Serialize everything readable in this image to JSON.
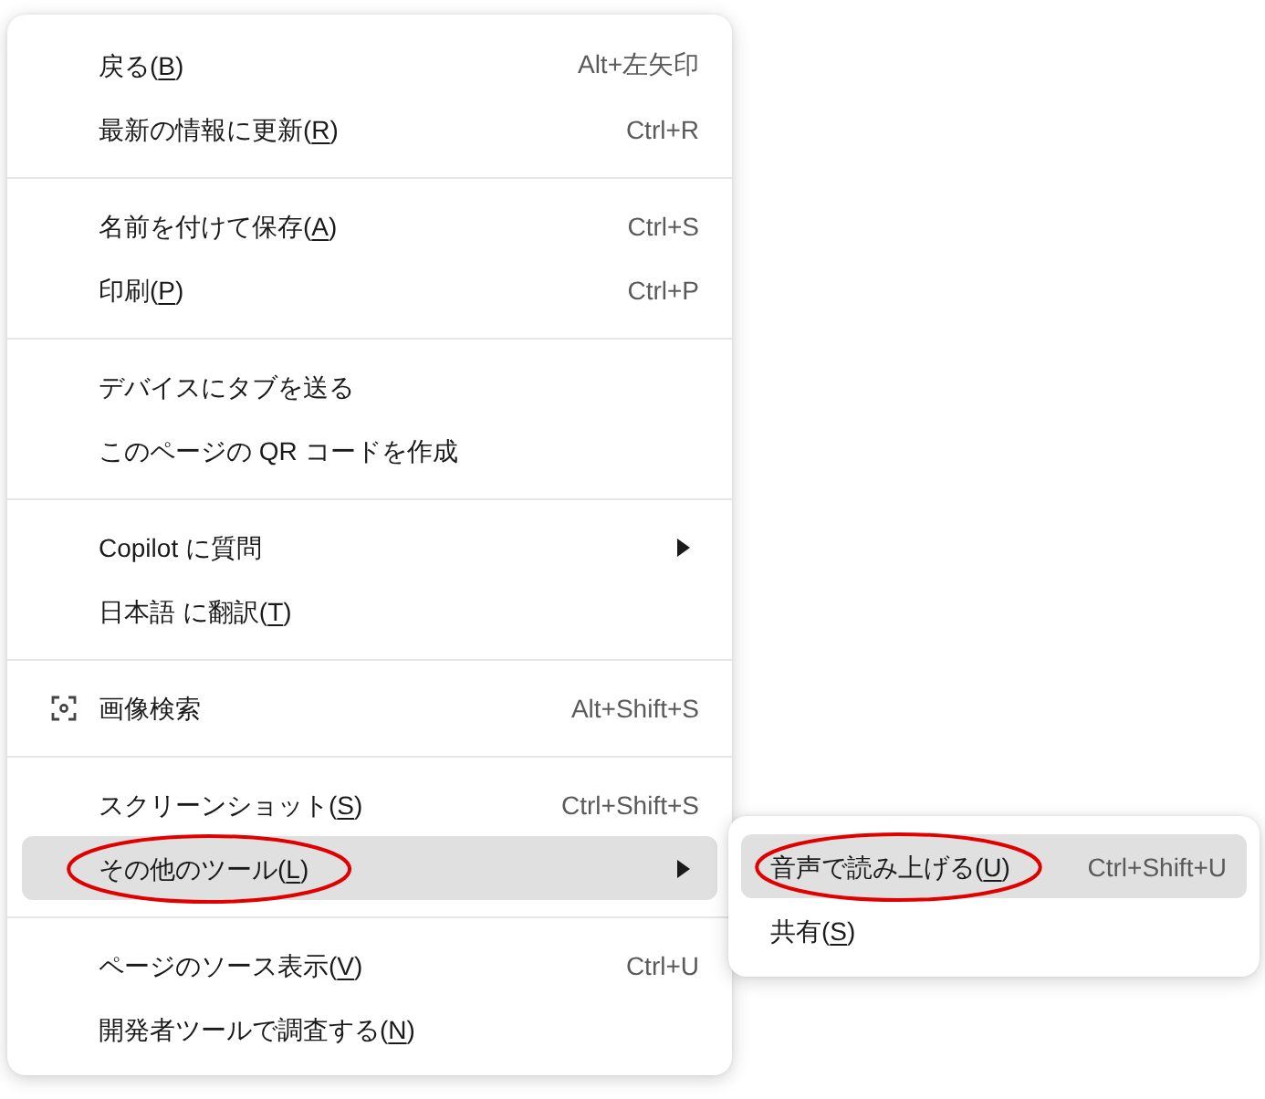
{
  "context_menu": {
    "sections": [
      {
        "items": [
          {
            "label": "戻る(",
            "access_key": "B",
            "label_end": ")",
            "shortcut": "Alt+左矢印",
            "has_icon": false,
            "has_submenu": false,
            "selected": false,
            "circled": false
          },
          {
            "label": "最新の情報に更新(",
            "access_key": "R",
            "label_end": ")",
            "shortcut": "Ctrl+R",
            "has_icon": false,
            "has_submenu": false,
            "selected": false,
            "circled": false
          }
        ]
      },
      {
        "items": [
          {
            "label": "名前を付けて保存(",
            "access_key": "A",
            "label_end": ")",
            "shortcut": "Ctrl+S",
            "has_icon": false,
            "has_submenu": false,
            "selected": false,
            "circled": false
          },
          {
            "label": "印刷(",
            "access_key": "P",
            "label_end": ")",
            "shortcut": "Ctrl+P",
            "has_icon": false,
            "has_submenu": false,
            "selected": false,
            "circled": false
          }
        ]
      },
      {
        "items": [
          {
            "label": "デバイスにタブを送る",
            "has_icon": false,
            "has_submenu": false,
            "selected": false,
            "circled": false
          },
          {
            "label": "このページの QR コードを作成",
            "has_icon": false,
            "has_submenu": false,
            "selected": false,
            "circled": false
          }
        ]
      },
      {
        "items": [
          {
            "label": "Copilot に質問",
            "has_icon": false,
            "has_submenu": true,
            "selected": false,
            "circled": false
          },
          {
            "label": "日本語 に翻訳(",
            "access_key": "T",
            "label_end": ")",
            "has_icon": false,
            "has_submenu": false,
            "selected": false,
            "circled": false
          }
        ]
      },
      {
        "items": [
          {
            "label": "画像検索",
            "shortcut": "Alt+Shift+S",
            "has_icon": true,
            "has_submenu": false,
            "selected": false,
            "circled": false
          }
        ]
      },
      {
        "items": [
          {
            "label": "スクリーンショット(",
            "access_key": "S",
            "label_end": ")",
            "shortcut": "Ctrl+Shift+S",
            "has_icon": false,
            "has_submenu": false,
            "selected": false,
            "circled": false
          },
          {
            "label": "その他のツール(",
            "access_key": "L",
            "label_end": ")",
            "has_icon": false,
            "has_submenu": true,
            "selected": true,
            "circled": true
          }
        ]
      },
      {
        "items": [
          {
            "label": "ページのソース表示(",
            "access_key": "V",
            "label_end": ")",
            "shortcut": "Ctrl+U",
            "has_icon": false,
            "has_submenu": false,
            "selected": false,
            "circled": false
          },
          {
            "label": "開発者ツールで調査する(",
            "access_key": "N",
            "label_end": ")",
            "has_icon": false,
            "has_submenu": false,
            "selected": false,
            "circled": false
          }
        ]
      }
    ]
  },
  "submenu": {
    "items": [
      {
        "label": "音声で読み上げる(",
        "access_key": "U",
        "label_end": ")",
        "shortcut": "Ctrl+Shift+U",
        "selected": true,
        "circled": true
      },
      {
        "label": "共有(",
        "access_key": "S",
        "label_end": ")",
        "selected": false,
        "circled": false
      }
    ]
  }
}
